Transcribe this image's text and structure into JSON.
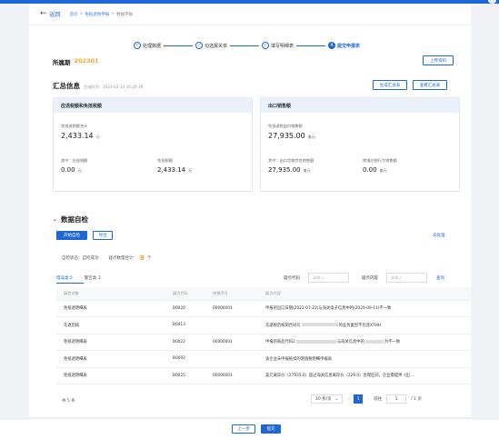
{
  "header": {
    "back_label": "返回",
    "breadcrumb": [
      "首页",
      "免抵退税申报",
      "数据申报"
    ],
    "breadcrumb_sep": ">"
  },
  "steps": [
    {
      "label": "处理数据",
      "icon": "✓"
    },
    {
      "label": "勾选报关单",
      "icon": "✓"
    },
    {
      "label": "填写明细表",
      "icon": "✓"
    },
    {
      "label": "提交申报表",
      "icon": "4"
    }
  ],
  "period": {
    "label": "所属期",
    "value": "202301"
  },
  "upload_button": "上传资料",
  "summary": {
    "title": "汇总信息",
    "time": "生成时间：2023-02-14 16:29:39",
    "generate_button": "生成汇总表",
    "view_button": "查看汇总表",
    "left_panel": {
      "title": "应退税额和免抵税额",
      "total_label": "免抵退税额合计",
      "total_value": "2,433.14",
      "unit": "元",
      "sub1_label": "其中：应退税额",
      "sub1_value": "0.00",
      "sub2_label": "免抵税额",
      "sub2_value": "2,433.14"
    },
    "right_panel": {
      "title": "出口销售额",
      "total_label": "免抵退税出口销售额",
      "total_value": "27,935.00",
      "unit": "美元",
      "sub1_label": "其中：出口货物劳务销售额",
      "sub1_value": "27,935.00",
      "sub2_label": "跨境应税行为销售额",
      "sub2_value": "0.00"
    }
  },
  "self_check": {
    "title": "数据自检",
    "start_button": "开始自检",
    "export_button": "导出",
    "deal_link": "去处理",
    "status_label": "自检状态：自检成功",
    "count_label": "疑点数量合计：",
    "count_value": "8",
    "count_unit": "个",
    "tabs": [
      "错误类 5",
      "警告类 3"
    ],
    "filter_code_label": "疑点代码",
    "filter_code_placeholder": "请输入",
    "filter_content_label": "疑点内容",
    "filter_content_placeholder": "请输入",
    "search_label": "查询",
    "columns": [
      "疑点对象",
      "疑点代码",
      "申报序号",
      "疑点内容"
    ],
    "rows": [
      {
        "obj": "免抵退明细表",
        "code": "B0020",
        "seq": "00000001",
        "c1": "申报的出口日期(2022-07-22)与海关电子信息中的(2020-09-11)不一致",
        "c2": ""
      },
      {
        "obj": "先退后核",
        "code": "B0413",
        "seq": "",
        "c1": "先退税后核销合同号",
        "c2": "的业务类型不包含XTHH"
      },
      {
        "obj": "免抵退明细表",
        "code": "B0022",
        "seq": "00000001",
        "c1": "申报的商品代码2",
        "c2": "与海关信息中的",
        "c3": "为不一致"
      },
      {
        "obj": "免抵退明细表",
        "code": "B0092",
        "seq": "",
        "c1": "该企业未申报抵扣的增值税明细申报表",
        "c2": ""
      },
      {
        "obj": "免抵退明细表",
        "code": "B0025",
        "seq": "00000001",
        "c1": "美元离岸价（27935.0）超过海关信息离岸价（229.0）合理区间，企业需提供《出…",
        "c2": ""
      }
    ],
    "total": "共 5 条",
    "pager": {
      "page_size": "10 条/页",
      "current": "1",
      "goto_label": "前往",
      "goto_value": "1",
      "pages_label": "/ 1 页"
    }
  },
  "footer": {
    "prev_button": "上一步",
    "submit_button": "提交"
  }
}
